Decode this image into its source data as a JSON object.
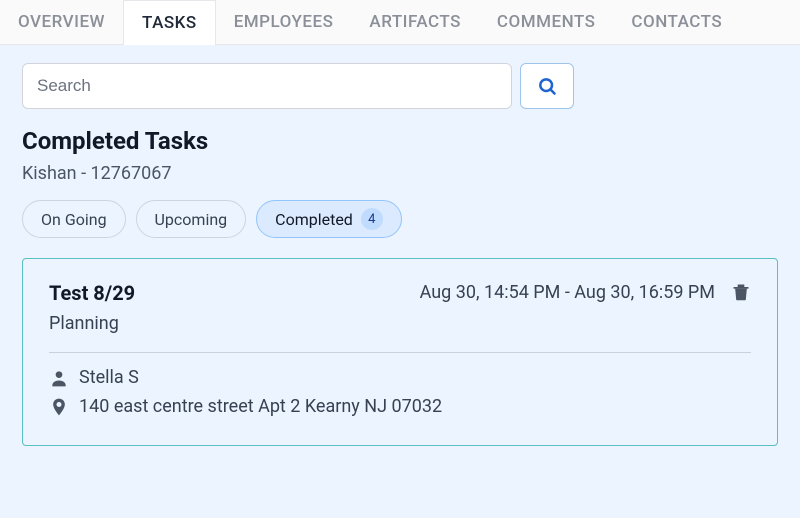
{
  "tabs": {
    "overview": "OVERVIEW",
    "tasks": "TASKS",
    "employees": "EMPLOYEES",
    "artifacts": "ARTIFACTS",
    "comments": "COMMENTS",
    "contacts": "CONTACTS"
  },
  "search": {
    "placeholder": "Search"
  },
  "heading": "Completed Tasks",
  "subtitle": "Kishan - 12767067",
  "filters": {
    "ongoing": "On Going",
    "upcoming": "Upcoming",
    "completed": "Completed",
    "completed_count": "4"
  },
  "task": {
    "title": "Test 8/29",
    "category": "Planning",
    "time_range": "Aug 30, 14:54 PM - Aug 30, 16:59 PM",
    "assignee": "Stella S",
    "address": "140 east centre street Apt 2 Kearny NJ 07032"
  }
}
